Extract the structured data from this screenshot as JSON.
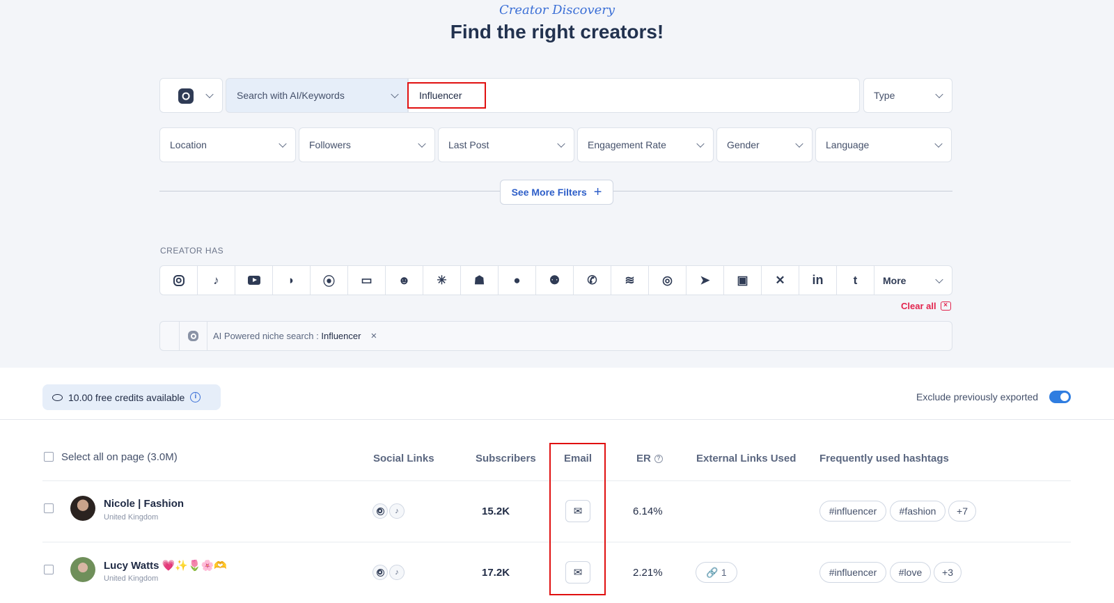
{
  "header": {
    "kicker": "Creator Discovery",
    "title": "Find the right creators!"
  },
  "search": {
    "platform_icon": "instagram-icon",
    "mode_label": "Search with AI/Keywords",
    "query_value": "Influencer",
    "type_label": "Type"
  },
  "filters": [
    "Location",
    "Followers",
    "Last Post",
    "Engagement Rate",
    "Gender",
    "Language"
  ],
  "see_more_label": "See More Filters",
  "creator_has": {
    "label": "CREATOR HAS",
    "icons": [
      "instagram-icon",
      "tiktok-icon",
      "youtube-icon",
      "bluesky-icon",
      "patreon-icon",
      "twitch-icon",
      "discord-icon",
      "linktree-icon",
      "snapchat-icon",
      "facebook-icon",
      "groups-icon",
      "phone-icon",
      "spotify-icon",
      "whatsapp-icon",
      "telegram-icon",
      "vk-icon",
      "x-icon",
      "linkedin-icon",
      "tumblr-icon"
    ],
    "more_label": "More",
    "clear_label": "Clear all"
  },
  "active_filter": {
    "prefix": "AI Powered niche search : ",
    "value": "Influencer",
    "remove": "×"
  },
  "credits": {
    "label": "10.00 free credits available"
  },
  "exclude": {
    "label": "Exclude previously exported",
    "enabled": true
  },
  "table": {
    "select_all": "Select all on page (3.0M)",
    "columns": {
      "social": "Social Links",
      "subscribers": "Subscribers",
      "email": "Email",
      "er": "ER",
      "links": "External Links Used",
      "hashtags": "Frequently used hashtags"
    },
    "rows": [
      {
        "name": "Nicole | Fashion",
        "location": "United Kingdom",
        "subscribers": "15.2K",
        "er": "6.14%",
        "links": "",
        "hashtags": [
          "#influencer",
          "#fashion",
          "+7"
        ]
      },
      {
        "name": "Lucy Watts 💗✨🌷🌸🫶",
        "location": "United Kingdom",
        "subscribers": "17.2K",
        "er": "2.21%",
        "links": "1",
        "hashtags": [
          "#influencer",
          "#love",
          "+3"
        ]
      }
    ]
  },
  "colors": {
    "accent": "#2f7de0",
    "highlight": "#e01010",
    "danger": "#e2244d"
  }
}
